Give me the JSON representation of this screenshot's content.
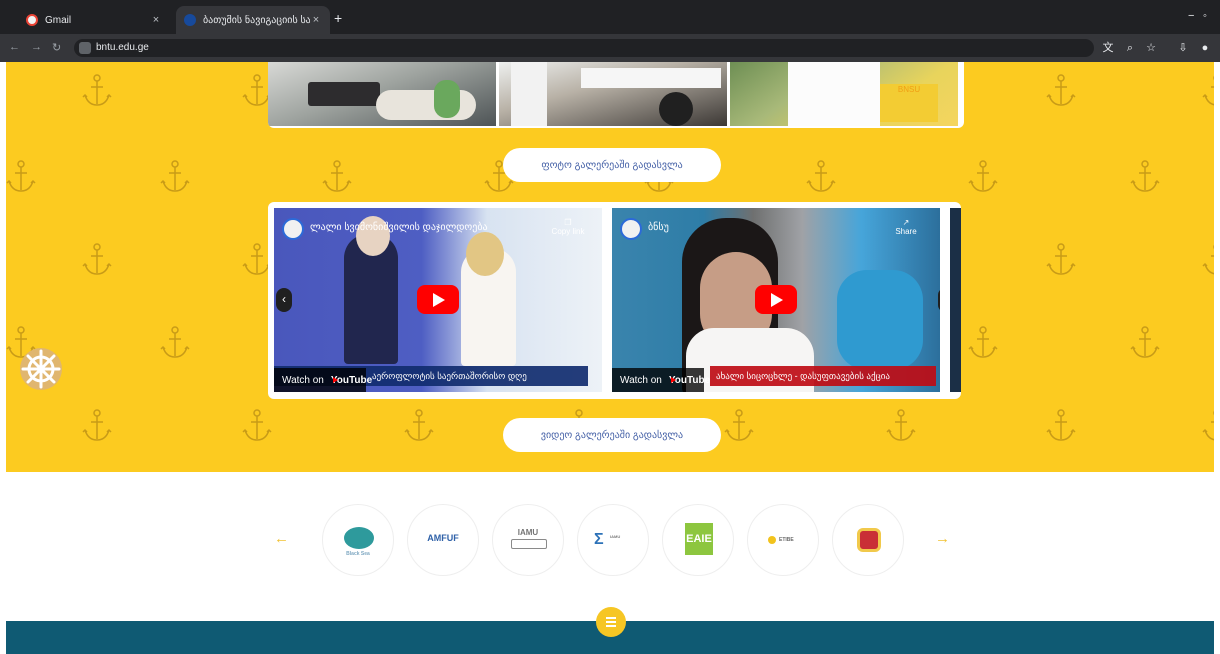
{
  "browser": {
    "tabs": [
      {
        "label": "Gmail",
        "active": false
      },
      {
        "label": "ბათუმის ნავიგაციის სასწა...",
        "active": true
      }
    ],
    "new_tab_icon": "plus-icon",
    "url": "bntu.edu.ge",
    "toolbar_icons": [
      "translate-icon",
      "zoom-icon",
      "bookmark-icon",
      "downloads-icon",
      "profile-icon"
    ]
  },
  "page": {
    "photo_gallery_button": "ფოტო გალერეაში გადასვლა",
    "video_gallery_button": "ვიდეო გალერეაში გადასვლა",
    "videos": [
      {
        "title": "ლალი სვიმონიშვილის დაჯილდოება",
        "copy_label": "Copy link",
        "watch_on": "Watch on",
        "youtube": "YouTube",
        "caption": "აეროფლოტის საერთაშორისო დღე"
      },
      {
        "title": "ბნსუ",
        "copy_label": "Share",
        "watch_on": "Watch on",
        "youtube": "YouTube",
        "caption": "ახალი სიცოცხლე - დასუფთავების აქცია"
      }
    ],
    "partners": [
      {
        "name": "Black Sea Network",
        "logo": "globe-logo"
      },
      {
        "name": "AMFUF",
        "logo": "amfuf-logo"
      },
      {
        "name": "IAMU",
        "logo": "ship-logo"
      },
      {
        "name": "International Association of Maritime Universities",
        "logo": "sigma-logo"
      },
      {
        "name": "EAIE",
        "logo": "eaie-logo"
      },
      {
        "name": "ETIBE",
        "logo": "sun-logo"
      },
      {
        "name": "Georgia",
        "logo": "coat-of-arms-logo"
      }
    ],
    "colors": {
      "yellow": "#fccb20",
      "footer_teal": "#0f5a73",
      "link_blue": "#4561a7"
    }
  }
}
